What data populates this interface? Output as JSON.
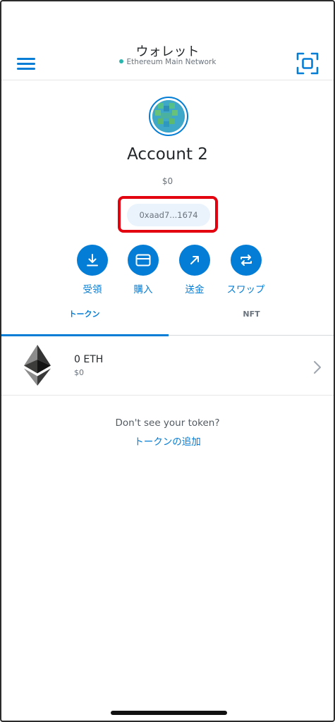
{
  "header": {
    "title": "ウォレット",
    "network": "Ethereum Main Network",
    "menu_icon": "hamburger-menu-icon",
    "scan_icon": "qr-scan-icon"
  },
  "account": {
    "name": "Account 2",
    "balance": "$0",
    "address": "0xaad7...1674"
  },
  "actions": [
    {
      "label": "受領",
      "icon": "receive-icon"
    },
    {
      "label": "購入",
      "icon": "buy-card-icon"
    },
    {
      "label": "送金",
      "icon": "send-arrow-icon"
    },
    {
      "label": "スワップ",
      "icon": "swap-icon"
    }
  ],
  "tabs": [
    {
      "label": "トークン",
      "active": true
    },
    {
      "label": "NFT",
      "active": false
    }
  ],
  "tokens": [
    {
      "amount": "0 ETH",
      "fiat": "$0",
      "icon": "ethereum-icon"
    }
  ],
  "footer": {
    "dont_see": "Don't see your token?",
    "add_token": "トークンの追加"
  },
  "colors": {
    "accent": "#037dd6",
    "highlight": "#e3000f",
    "network_dot": "#29b6af"
  }
}
